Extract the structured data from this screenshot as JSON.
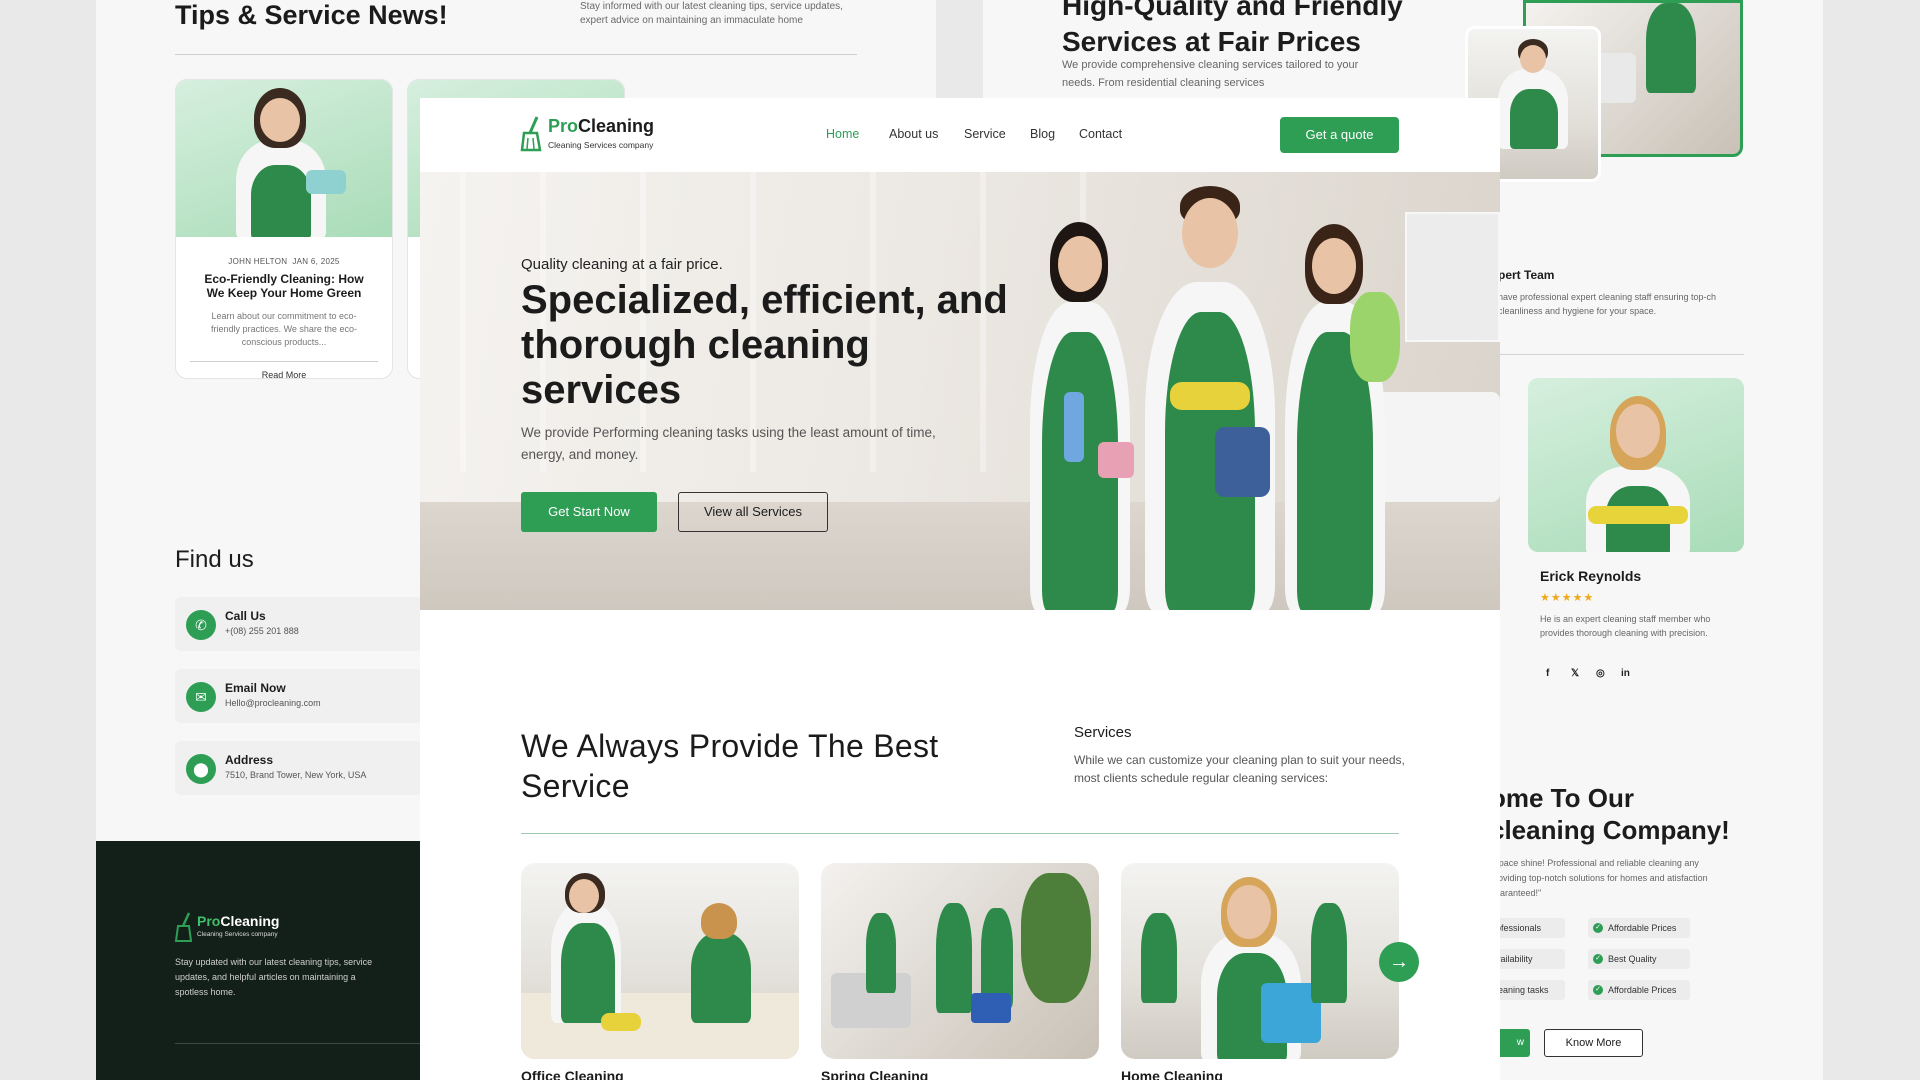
{
  "left_page": {
    "news_title": "Tips & Service News!",
    "news_sub": "Stay informed with our latest cleaning tips, service updates, expert advice on maintaining an immaculate home",
    "blog": {
      "author": "JOHN HELTON",
      "date": "JAN 6, 2025",
      "title": "Eco-Friendly Cleaning: How We Keep Your Home Green",
      "text": "Learn about our commitment to eco-friendly practices. We share the eco-conscious products...",
      "read_more": "Read More"
    },
    "find_us": "Find us",
    "contacts": [
      {
        "label": "Call Us",
        "value": "+(08) 255 201 888",
        "icon": "phone-icon"
      },
      {
        "label": "Email Now",
        "value": "Hello@procleaning.com",
        "icon": "mail-icon"
      },
      {
        "label": "Address",
        "value": "7510, Brand Tower, New York, USA",
        "icon": "location-icon"
      }
    ],
    "footer": {
      "brand_pro": "Pro",
      "brand_rest": "Cleaning",
      "tagline": "Cleaning Services company",
      "text": "Stay updated with our latest cleaning tips, service updates, and helpful articles on maintaining a spotless home."
    }
  },
  "right_page": {
    "heading_line1": "High-Quality and Friendly",
    "heading_line2": "Services at Fair Prices",
    "sub": "We provide comprehensive cleaning services tailored to your needs. From residential cleaning services",
    "team_title": "pert Team",
    "team_text": "have professional expert cleaning staff ensuring top-ch cleanliness and hygiene for your space.",
    "member": {
      "name": "Erick Reynolds",
      "stars": "★★★★★",
      "text": "He is an expert cleaning staff member who provides thorough cleaning with precision.",
      "social": [
        "f",
        "𝕏",
        "◎",
        "in"
      ]
    },
    "welcome_line1": "ome To Our",
    "welcome_line2": "cleaning Company!",
    "welcome_text": "' space shine! Professional and reliable cleaning any providing top-notch solutions for homes and atisfaction guaranteed!\"",
    "features_left": [
      "ofessionals",
      "vailability",
      "leaning tasks"
    ],
    "features_right": [
      "Affordable Prices",
      "Best Quality",
      "Affordable Prices"
    ],
    "green_stub": "w",
    "know_more": "Know More"
  },
  "main": {
    "logo": {
      "pro": "Pro",
      "rest": "Cleaning",
      "tagline": "Cleaning Services company"
    },
    "nav": [
      "Home",
      "About us",
      "Service",
      "Blog",
      "Contact"
    ],
    "quote_button": "Get a quote",
    "hero": {
      "tagline": "Quality cleaning at a fair price.",
      "title": "Specialized, efficient, and thorough cleaning services",
      "desc": "We provide Performing cleaning tasks using the least amount of time, energy, and money.",
      "btn_start": "Get  Start Now",
      "btn_all": "View all Services"
    },
    "section": {
      "title": "We Always Provide The Best Service",
      "label": "Services",
      "desc": "While we can customize your cleaning plan to suit your needs, most clients schedule regular cleaning services:"
    },
    "services": [
      "Office Cleaning",
      "Spring Cleaning",
      "Home Cleaning"
    ]
  },
  "colors": {
    "accent": "#2e9e55",
    "dark": "#13201a",
    "text": "#1b1b1b"
  }
}
